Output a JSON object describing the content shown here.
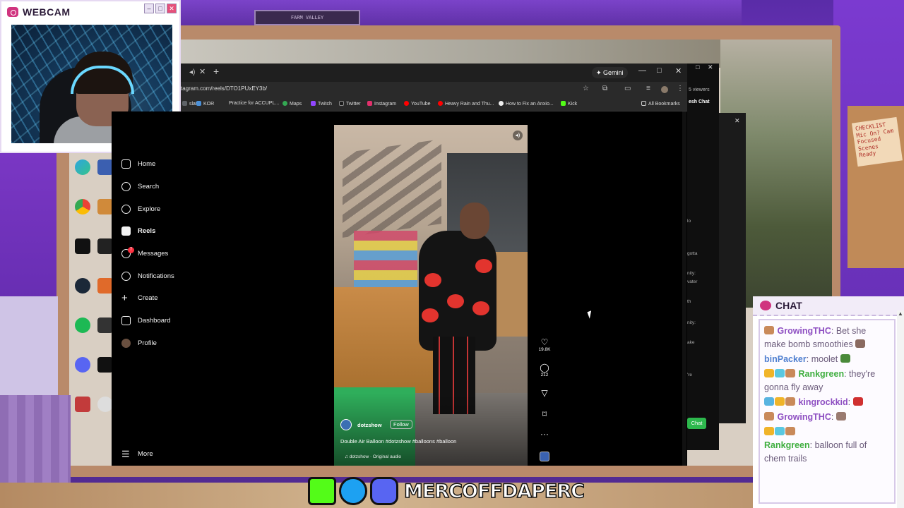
{
  "webcam": {
    "title": "WEBCAM",
    "controls": [
      "minimize",
      "maximize",
      "close"
    ]
  },
  "scene": {
    "shelf_sign": "FARM VALLEY",
    "note_text": "CHECKLIST Mic On? Cam Focused Scenes Ready"
  },
  "browser": {
    "url": "tagram.com/reels/DTO1PUxEY3b/",
    "gemini_label": "Gemini",
    "bookmarks": [
      {
        "label": "slate",
        "color": "#5f6368"
      },
      {
        "label": "KOR",
        "color": "#4a90d9"
      },
      {
        "label": "Practice for ACCUPL...",
        "color": "#3c3c3c"
      },
      {
        "label": "Maps",
        "color": "#34a853"
      },
      {
        "label": "Twitch",
        "color": "#9146ff"
      },
      {
        "label": "Twitter",
        "color": "#1a1a1a"
      },
      {
        "label": "Instagram",
        "color": "#e1306c"
      },
      {
        "label": "YouTube",
        "color": "#ff0000"
      },
      {
        "label": "Heavy Rain and Thu...",
        "color": "#ff0000"
      },
      {
        "label": "How to Fix an Anxio...",
        "color": "#eeeeee"
      },
      {
        "label": "Kick",
        "color": "#53fc18"
      }
    ],
    "all_bookmarks": "All Bookmarks"
  },
  "instagram": {
    "nav": [
      {
        "label": "Home",
        "icon": "home-icon"
      },
      {
        "label": "Search",
        "icon": "search-icon"
      },
      {
        "label": "Explore",
        "icon": "compass-icon"
      },
      {
        "label": "Reels",
        "icon": "reels-icon"
      },
      {
        "label": "Messages",
        "icon": "messages-icon",
        "badge": "7"
      },
      {
        "label": "Notifications",
        "icon": "heart-icon"
      },
      {
        "label": "Create",
        "icon": "plus-icon"
      },
      {
        "label": "Dashboard",
        "icon": "dashboard-icon"
      },
      {
        "label": "Profile",
        "icon": "profile-avatar"
      }
    ],
    "more": "More",
    "reel": {
      "username": "dotzshow",
      "follow": "Follow",
      "caption": "Double Air Balloon #dotzshow #balloons #balloon",
      "audio": "dotzshow · Original audio",
      "likes": "19.8K",
      "comments": "212"
    }
  },
  "behind_window": {
    "viewers": "5 viewers",
    "fresh_chat": "esh Chat",
    "chat_button": "Chat",
    "snippets": [
      "lo",
      "gotta",
      "nity:",
      "vater",
      "th",
      "nity:",
      "ake",
      "'re"
    ]
  },
  "chat": {
    "title": "CHAT",
    "messages": [
      {
        "user": "GrowingTHC",
        "user_color": "#8e4fc2",
        "text": "Bet she make bomb smoothies",
        "badges": [
          "#c98a5a"
        ],
        "emote": "#8a6a60"
      },
      {
        "user": "binPacker",
        "user_color": "#4f7fd0",
        "text": "moolet",
        "badges": [],
        "emote": "#4a8a3a"
      },
      {
        "user": "Rankgreen",
        "user_color": "#3fae3f",
        "text": "they're gonna fly away",
        "badges": [
          "#f0b429",
          "#5ac8e0",
          "#c98a5a"
        ],
        "emote": ""
      },
      {
        "user": "kingrockkid",
        "user_color": "#8e4fc2",
        "text": "",
        "badges": [
          "#58b4e0",
          "#f0b429",
          "#c98a5a"
        ],
        "emote": "#d03030"
      },
      {
        "user": "GrowingTHC",
        "user_color": "#8e4fc2",
        "text": "",
        "badges": [
          "#c98a5a"
        ],
        "emote": "#9a7a70"
      },
      {
        "user": "Rankgreen",
        "user_color": "#3fae3f",
        "text": "balloon full of chem trails",
        "badges": [
          "#f0b429",
          "#5ac8e0",
          "#c98a5a"
        ],
        "emote": ""
      }
    ]
  },
  "social": {
    "handle": "MERCOFFDAPERC",
    "icons": [
      {
        "name": "kick-icon",
        "color": "#53fc18"
      },
      {
        "name": "twitter-icon",
        "color": "#1da1f2"
      },
      {
        "name": "discord-icon",
        "color": "#5865f2"
      }
    ]
  }
}
